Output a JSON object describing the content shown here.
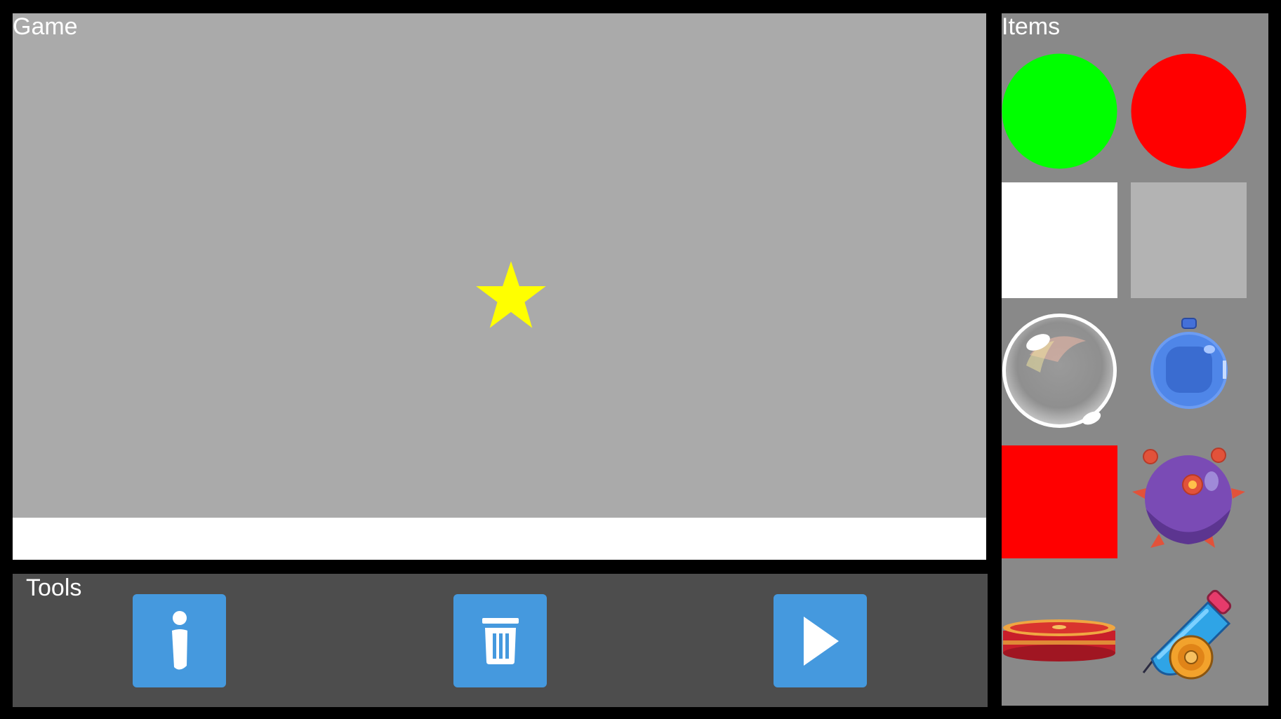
{
  "game": {
    "title": "Game"
  },
  "tools": {
    "title": "Tools",
    "buttons": [
      {
        "name": "info",
        "icon": "info-icon"
      },
      {
        "name": "delete",
        "icon": "trash-icon"
      },
      {
        "name": "play",
        "icon": "play-icon"
      }
    ],
    "button_color": "#4599de"
  },
  "items": {
    "title": "Items",
    "list": [
      {
        "name": "green-circle",
        "color": "#00ff00"
      },
      {
        "name": "red-circle",
        "color": "#ff0000"
      },
      {
        "name": "white-square",
        "color": "#ffffff"
      },
      {
        "name": "gray-square",
        "color": "#b3b3b3"
      },
      {
        "name": "bubble",
        "icon": "bubble-icon"
      },
      {
        "name": "blue-bomb",
        "icon": "blue-bomb-icon"
      },
      {
        "name": "red-square",
        "color": "#ff0000"
      },
      {
        "name": "spiked-mine",
        "icon": "spiked-mine-icon"
      },
      {
        "name": "trampoline",
        "icon": "trampoline-icon"
      },
      {
        "name": "cannon",
        "icon": "cannon-icon"
      }
    ]
  },
  "colors": {
    "background": "#000000",
    "game_area": "#aaaaaa",
    "floor": "#ffffff",
    "tools_bg": "#4d4d4d",
    "items_bg": "#898989",
    "star": "#ffff00"
  }
}
